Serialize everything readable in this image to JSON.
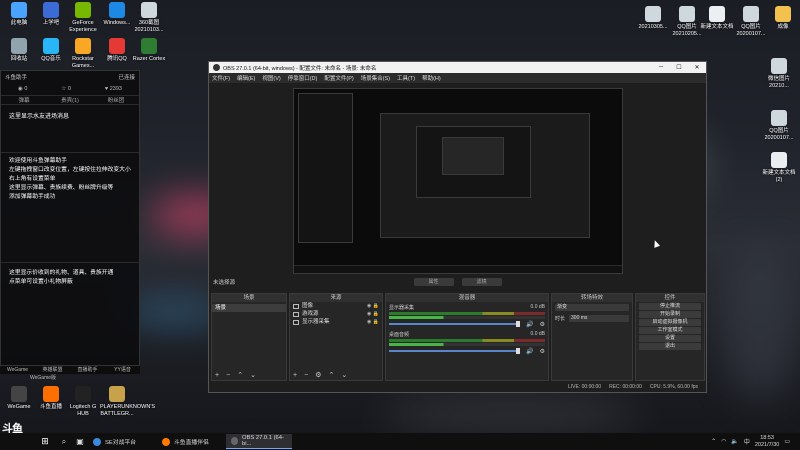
{
  "desktop_icons_left": [
    {
      "label": "此电脑",
      "icon": "computer-icon"
    },
    {
      "label": "上学吧",
      "icon": "globe-icon"
    },
    {
      "label": "GeForce Experience",
      "icon": "nvidia-icon"
    },
    {
      "label": "Windows...",
      "icon": "windows-icon"
    },
    {
      "label": "360截图 20210103...",
      "icon": "image-icon"
    },
    {
      "label": "回收站",
      "icon": "recycle-icon"
    },
    {
      "label": "QQ音乐",
      "icon": "music-icon"
    },
    {
      "label": "Rockstar Games...",
      "icon": "rockstar-icon"
    },
    {
      "label": "腾讯QQ",
      "icon": "qq-icon"
    },
    {
      "label": "Razer Cortex",
      "icon": "razer-icon"
    },
    {
      "label": "WeGame",
      "icon": "wegame-icon"
    },
    {
      "label": "斗鱼直播",
      "icon": "douyu-icon"
    },
    {
      "label": "Logitech G HUB",
      "icon": "logitech-icon"
    },
    {
      "label": "PLAYERUNKNOWN'S BATTLEGR...",
      "icon": "pubg-icon"
    }
  ],
  "desktop_icons_right": [
    {
      "label": "20210305...",
      "icon": "image-icon"
    },
    {
      "label": "QQ图片 20210205...",
      "icon": "image-icon"
    },
    {
      "label": "新建文本文档",
      "icon": "text-file-icon"
    },
    {
      "label": "QQ图片 20200107...",
      "icon": "image-icon"
    },
    {
      "label": "成像",
      "icon": "folder-icon"
    },
    {
      "label": "微信图片 20210...",
      "icon": "image-icon"
    },
    {
      "label": "QQ图片 20200107...",
      "icon": "image-icon"
    },
    {
      "label": "新建文本文档 (2)",
      "icon": "text-file-icon"
    }
  ],
  "helper": {
    "title": "斗鱼助手",
    "status": "已连接",
    "stats": [
      "0",
      "0",
      "2393"
    ],
    "tabs": [
      "弹幕",
      "贵宾(1)",
      "粉丝团"
    ],
    "notice": "这里显示水友进场消息",
    "body_lines": [
      "欢迎使用斗鱼弹幕助手",
      "左键拖拽窗口改变位置，左键按住拉伸改变大小",
      "右上角有设置菜单",
      "这里显示弹幕、贵族续费、粉丝牌升级等",
      "添加弹幕助手成功"
    ],
    "gift_lines": [
      "这里显示价收到的礼物、道具、贵族开通",
      "点菜单可设置小礼物屏蔽"
    ],
    "bottom_tabs": [
      "WeGame",
      "英雄联盟",
      "直播助手",
      "YY语音"
    ],
    "bottom_sub": "WeGame版"
  },
  "obs": {
    "title": "OBS 27.0.1 (64-bit, windows) - 配置文件: 未命名 - 场景: 未命名",
    "menu": [
      "文件(F)",
      "编辑(E)",
      "视图(V)",
      "停靠窗口(D)",
      "配置文件(P)",
      "场景集合(S)",
      "工具(T)",
      "帮助(H)"
    ],
    "mode_label": "未选择源",
    "switch_buttons": [
      "属性",
      "滤镜"
    ],
    "scenes_title": "场景",
    "scene_item": "场景",
    "sources_title": "来源",
    "sources": [
      "图像",
      "游戏源",
      "显示器采集"
    ],
    "mixer_title": "混音器",
    "tracks": [
      {
        "name": "显示器采集",
        "db": "0.0 dB"
      },
      {
        "name": "桌面音频",
        "db": "0.0 dB"
      }
    ],
    "transitions_title": "转场特效",
    "transition_value": "渐变",
    "duration_label": "时长",
    "duration_value": "300 ms",
    "controls_title": "控件",
    "controls": [
      "停止推流",
      "开始录制",
      "启动虚拟摄像机",
      "工作室模式",
      "设置",
      "退出"
    ],
    "status": {
      "live_label": "LIVE:",
      "live_time": "00:00:00",
      "rec_label": "REC:",
      "rec_time": "00:00:00",
      "cpu": "CPU: 5.9%, 60.00 fps"
    }
  },
  "taskbar": {
    "apps": [
      {
        "label": "SE对战平台",
        "color": "#3a8bdc"
      },
      {
        "label": "斗鱼直播伴侣",
        "color": "#ff7a00"
      },
      {
        "label": "OBS 27.0.1 (64-bi...",
        "color": "#666666"
      }
    ],
    "tray_lang": "中",
    "time": "18:53",
    "date": "2021/7/30"
  },
  "brand": {
    "name": "斗鱼",
    "sub": "直播间",
    "num": "3754779"
  }
}
